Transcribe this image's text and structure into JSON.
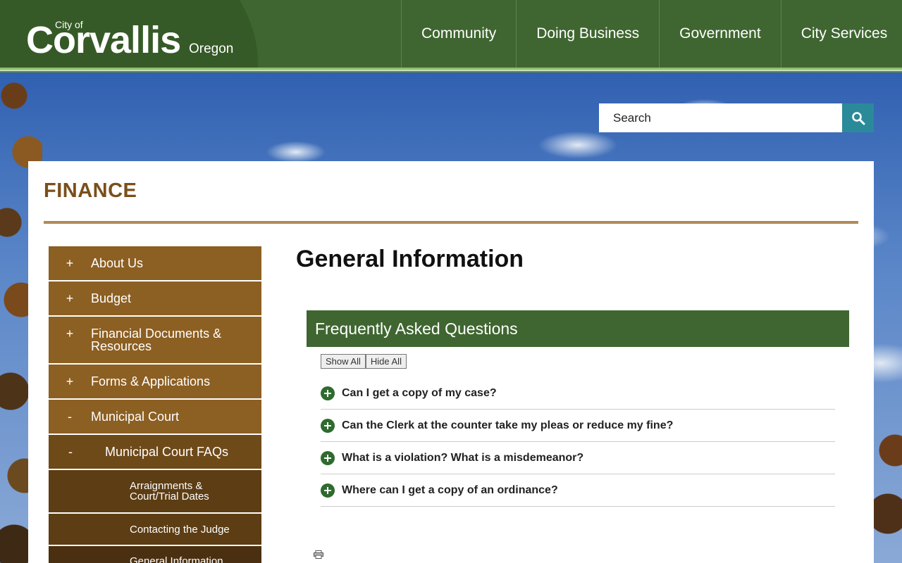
{
  "header": {
    "logo": {
      "city_of": "City of",
      "name": "Corvallis",
      "state": "Oregon"
    },
    "nav": [
      {
        "label": "Community"
      },
      {
        "label": "Doing Business"
      },
      {
        "label": "Government"
      },
      {
        "label": "City Services"
      }
    ]
  },
  "search": {
    "placeholder": "Search",
    "icon": "search-icon"
  },
  "department": {
    "title": "FINANCE"
  },
  "sidebar": {
    "items": [
      {
        "sign": "+",
        "label": "About Us"
      },
      {
        "sign": "+",
        "label": "Budget"
      },
      {
        "sign": "+",
        "label": "Financial Documents & Resources"
      },
      {
        "sign": "+",
        "label": "Forms & Applications"
      },
      {
        "sign": "-",
        "label": "Municipal Court"
      },
      {
        "sign": "-",
        "label": "Municipal Court FAQs"
      },
      {
        "label": "Arraignments & Court/Trial Dates"
      },
      {
        "label": "Contacting the Judge"
      },
      {
        "label": "General Information"
      }
    ]
  },
  "main": {
    "title": "General Information",
    "faq": {
      "header": "Frequently Asked Questions",
      "show_all": "Show All",
      "hide_all": "Hide All",
      "questions": [
        "Can I get a copy of my case?",
        "Can the Clerk at the counter take my pleas or reduce my fine?",
        "What is a violation? What is a misdemeanor?",
        "Where can I get a copy of an ordinance?"
      ]
    }
  },
  "colors": {
    "header_green": "#3f6630",
    "sidebar_brown": "#8c5f22",
    "title_brown": "#7a4f1a",
    "search_teal": "#2b8a9a"
  }
}
